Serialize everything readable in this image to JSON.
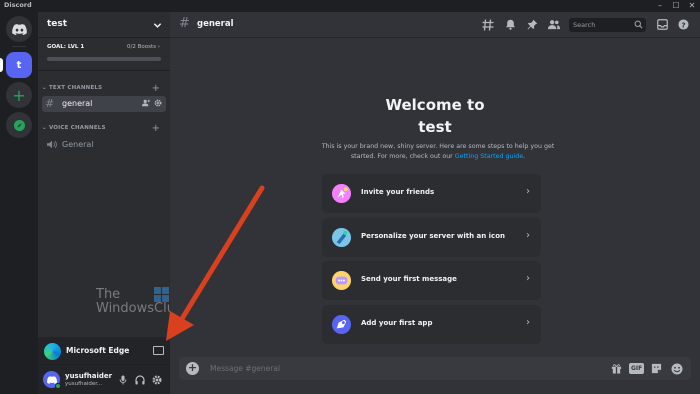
{
  "app": {
    "name": "Discord"
  },
  "window": {
    "minimize": "–",
    "maximize": "☐",
    "close": "✕"
  },
  "rail": {
    "active_server_initial": "t"
  },
  "server": {
    "name": "test",
    "goal_label": "GOAL: LVL 1",
    "boosts": "0/2 Boosts",
    "goal_progress": 0
  },
  "categories": {
    "text": "TEXT CHANNELS",
    "voice": "VOICE CHANNELS"
  },
  "channels": {
    "text": [
      {
        "name": "general",
        "active": true
      }
    ],
    "voice": [
      {
        "name": "General"
      }
    ]
  },
  "watermark": {
    "line1": "The",
    "line2": "WindowsClub"
  },
  "activity": {
    "label": "Microsoft Edge"
  },
  "user": {
    "name": "yusufhaider",
    "tag": "yusufhaider..."
  },
  "header": {
    "channel": "general",
    "search_placeholder": "Search"
  },
  "welcome": {
    "title_line1": "Welcome to",
    "title_line2": "test",
    "subtitle": "This is your brand new, shiny server. Here are some steps to help you get started. For more, check out our",
    "link": "Getting Started guide",
    "period": "."
  },
  "cards": [
    {
      "label": "Invite your friends",
      "icon": "invite-friends-icon"
    },
    {
      "label": "Personalize your server with an icon",
      "icon": "personalize-icon"
    },
    {
      "label": "Send your first message",
      "icon": "message-icon"
    },
    {
      "label": "Add your first app",
      "icon": "app-icon"
    }
  ],
  "composer": {
    "placeholder": "Message #general",
    "gif_label": "GIF"
  },
  "colors": {
    "blurple": "#5865f2",
    "green": "#23a55a",
    "link": "#00a8fc",
    "annotation_arrow": "#d9411e"
  }
}
